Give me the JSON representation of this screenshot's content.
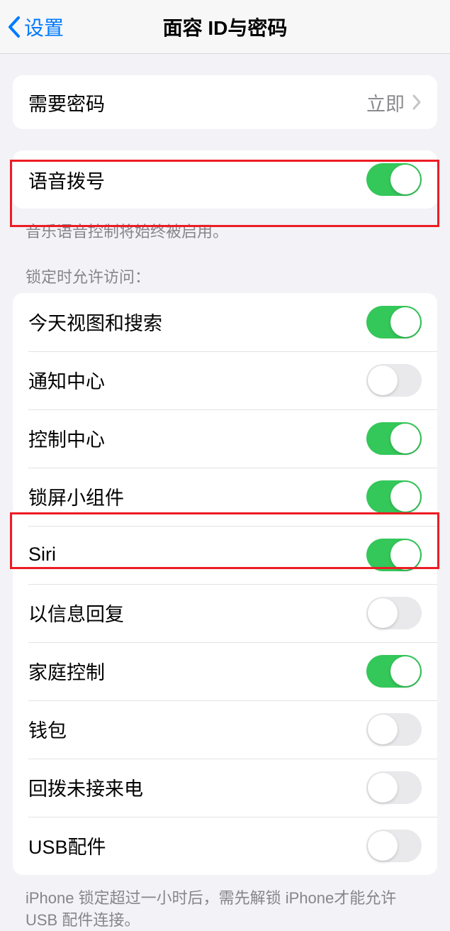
{
  "header": {
    "back_label": "设置",
    "title": "面容 ID与密码"
  },
  "passcode_group": {
    "require_passcode": {
      "label": "需要密码",
      "value": "立即"
    }
  },
  "voice_dial_group": {
    "voice_dial": {
      "label": "语音拨号",
      "on": true
    },
    "footer": "音乐语音控制将始终被启用。"
  },
  "lock_access_section": {
    "header": "锁定时允许访问：",
    "items": [
      {
        "label": "今天视图和搜索",
        "on": true
      },
      {
        "label": "通知中心",
        "on": false
      },
      {
        "label": "控制中心",
        "on": true
      },
      {
        "label": "锁屏小组件",
        "on": true
      },
      {
        "label": "Siri",
        "on": true
      },
      {
        "label": "以信息回复",
        "on": false
      },
      {
        "label": "家庭控制",
        "on": true
      },
      {
        "label": "钱包",
        "on": false
      },
      {
        "label": "回拨未接来电",
        "on": false
      },
      {
        "label": "USB配件",
        "on": false
      }
    ],
    "footer": "iPhone 锁定超过一小时后，需先解锁 iPhone才能允许USB 配件连接。"
  }
}
